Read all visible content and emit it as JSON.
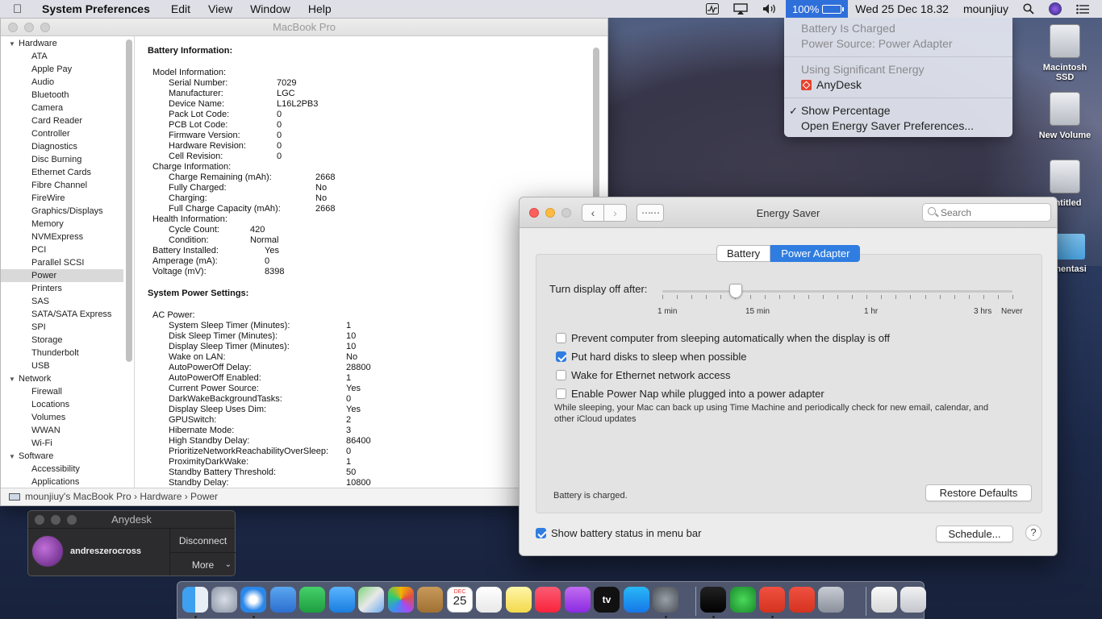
{
  "menubar": {
    "app": "System Preferences",
    "menus": [
      "Edit",
      "View",
      "Window",
      "Help"
    ],
    "battery_percent": "100%",
    "datetime": "Wed 25 Dec  18.32",
    "user": "mounjiuy"
  },
  "battery_menu": {
    "status": "Battery Is Charged",
    "source": "Power Source: Power Adapter",
    "energy_header": "Using Significant Energy",
    "energy_app": "AnyDesk",
    "show_percentage": "Show Percentage",
    "open_prefs": "Open Energy Saver Preferences..."
  },
  "desktop": {
    "icons": [
      "Macintosh SSD",
      "New Volume",
      "Untitled",
      "mentasi"
    ]
  },
  "sysinfo": {
    "title": "MacBook Pro",
    "tree": [
      {
        "label": "Hardware",
        "group": true
      },
      {
        "label": "ATA"
      },
      {
        "label": "Apple Pay"
      },
      {
        "label": "Audio"
      },
      {
        "label": "Bluetooth"
      },
      {
        "label": "Camera"
      },
      {
        "label": "Card Reader"
      },
      {
        "label": "Controller"
      },
      {
        "label": "Diagnostics"
      },
      {
        "label": "Disc Burning"
      },
      {
        "label": "Ethernet Cards"
      },
      {
        "label": "Fibre Channel"
      },
      {
        "label": "FireWire"
      },
      {
        "label": "Graphics/Displays"
      },
      {
        "label": "Memory"
      },
      {
        "label": "NVMExpress"
      },
      {
        "label": "PCI"
      },
      {
        "label": "Parallel SCSI"
      },
      {
        "label": "Power",
        "selected": true
      },
      {
        "label": "Printers"
      },
      {
        "label": "SAS"
      },
      {
        "label": "SATA/SATA Express"
      },
      {
        "label": "SPI"
      },
      {
        "label": "Storage"
      },
      {
        "label": "Thunderbolt"
      },
      {
        "label": "USB"
      },
      {
        "label": "Network",
        "group": true
      },
      {
        "label": "Firewall"
      },
      {
        "label": "Locations"
      },
      {
        "label": "Volumes"
      },
      {
        "label": "WWAN"
      },
      {
        "label": "Wi-Fi"
      },
      {
        "label": "Software",
        "group": true
      },
      {
        "label": "Accessibility"
      },
      {
        "label": "Applications"
      }
    ],
    "battery_heading": "Battery Information:",
    "battery_rows": [
      {
        "k": "Model Information:",
        "v": "",
        "indent": 0,
        "vx": 0
      },
      {
        "k": "Serial Number:",
        "v": "7029",
        "indent": 1,
        "vx": 134
      },
      {
        "k": "Manufacturer:",
        "v": "LGC",
        "indent": 1,
        "vx": 134
      },
      {
        "k": "Device Name:",
        "v": "L16L2PB3",
        "indent": 1,
        "vx": 134
      },
      {
        "k": "Pack Lot Code:",
        "v": "0",
        "indent": 1,
        "vx": 134
      },
      {
        "k": "PCB Lot Code:",
        "v": "0",
        "indent": 1,
        "vx": 134
      },
      {
        "k": "Firmware Version:",
        "v": "0",
        "indent": 1,
        "vx": 134
      },
      {
        "k": "Hardware Revision:",
        "v": "0",
        "indent": 1,
        "vx": 134
      },
      {
        "k": "Cell Revision:",
        "v": "0",
        "indent": 1,
        "vx": 134
      },
      {
        "k": "Charge Information:",
        "v": "",
        "indent": 0,
        "vx": 0
      },
      {
        "k": "Charge Remaining (mAh):",
        "v": "2668",
        "indent": 1,
        "vx": 182
      },
      {
        "k": "Fully Charged:",
        "v": "No",
        "indent": 1,
        "vx": 182
      },
      {
        "k": "Charging:",
        "v": "No",
        "indent": 1,
        "vx": 182
      },
      {
        "k": "Full Charge Capacity (mAh):",
        "v": "2668",
        "indent": 1,
        "vx": 182
      },
      {
        "k": "Health Information:",
        "v": "",
        "indent": 0,
        "vx": 0
      },
      {
        "k": "Cycle Count:",
        "v": "420",
        "indent": 1,
        "vx": 101
      },
      {
        "k": "Condition:",
        "v": "Normal",
        "indent": 1,
        "vx": 101
      },
      {
        "k": "Battery Installed:",
        "v": "Yes",
        "indent": 0,
        "vx": 119
      },
      {
        "k": "Amperage (mA):",
        "v": "0",
        "indent": 0,
        "vx": 119
      },
      {
        "k": "Voltage (mV):",
        "v": "8398",
        "indent": 0,
        "vx": 119
      }
    ],
    "power_heading": "System Power Settings:",
    "power_rows": [
      {
        "k": "AC Power:",
        "v": "",
        "indent": 0
      },
      {
        "k": "System Sleep Timer (Minutes):",
        "v": "1",
        "indent": 1
      },
      {
        "k": "Disk Sleep Timer (Minutes):",
        "v": "10",
        "indent": 1
      },
      {
        "k": "Display Sleep Timer (Minutes):",
        "v": "10",
        "indent": 1
      },
      {
        "k": "Wake on LAN:",
        "v": "No",
        "indent": 1
      },
      {
        "k": "AutoPowerOff Delay:",
        "v": "28800",
        "indent": 1
      },
      {
        "k": "AutoPowerOff Enabled:",
        "v": "1",
        "indent": 1
      },
      {
        "k": "Current Power Source:",
        "v": "Yes",
        "indent": 1
      },
      {
        "k": "DarkWakeBackgroundTasks:",
        "v": "0",
        "indent": 1
      },
      {
        "k": "Display Sleep Uses Dim:",
        "v": "Yes",
        "indent": 1
      },
      {
        "k": "GPUSwitch:",
        "v": "2",
        "indent": 1
      },
      {
        "k": "Hibernate Mode:",
        "v": "3",
        "indent": 1
      },
      {
        "k": "High Standby Delay:",
        "v": "86400",
        "indent": 1
      },
      {
        "k": "PrioritizeNetworkReachabilityOverSleep:",
        "v": "0",
        "indent": 1
      },
      {
        "k": "ProximityDarkWake:",
        "v": "1",
        "indent": 1
      },
      {
        "k": "Standby Battery Threshold:",
        "v": "50",
        "indent": 1
      },
      {
        "k": "Standby Delay:",
        "v": "10800",
        "indent": 1
      }
    ],
    "path": "mounjiuy's MacBook Pro  ›  Hardware  ›  Power"
  },
  "anydesk": {
    "title": "Anydesk",
    "user": "andreszerocross",
    "disconnect": "Disconnect",
    "more": "More"
  },
  "energy": {
    "title": "Energy Saver",
    "search_placeholder": "Search",
    "tabs": [
      "Battery",
      "Power Adapter"
    ],
    "active_tab": "Power Adapter",
    "slider_label": "Turn display off after:",
    "slider_value": "10 min",
    "slider_fraction": 0.21,
    "ticks": [
      "1 min",
      "15 min",
      "1 hr",
      "3 hrs",
      "Never"
    ],
    "options": [
      {
        "label": "Prevent computer from sleeping automatically when the display is off",
        "checked": false
      },
      {
        "label": "Put hard disks to sleep when possible",
        "checked": true
      },
      {
        "label": "Wake for Ethernet network access",
        "checked": false
      },
      {
        "label": "Enable Power Nap while plugged into a power adapter",
        "checked": false
      }
    ],
    "power_nap_desc": "While sleeping, your Mac can back up using Time Machine and periodically check for new email, calendar, and other iCloud updates",
    "status": "Battery is charged.",
    "restore": "Restore Defaults",
    "show_status": "Show battery status in menu bar",
    "show_status_checked": true,
    "schedule": "Schedule...",
    "help": "?"
  },
  "dock": {
    "apps": [
      "finder-icon",
      "launchpad-icon",
      "safari-icon",
      "mail-icon",
      "facetime-icon",
      "messages-icon",
      "maps-icon",
      "photos-icon",
      "contacts-icon",
      "calendar-icon",
      "reminders-icon",
      "notes-icon",
      "music-icon",
      "podcasts-icon",
      "tv-icon",
      "app-store-icon",
      "system-preferences-icon",
      "terminal-icon",
      "activity-icon",
      "anydesk-icon",
      "anydesk-icon-2",
      "utility-icon",
      "documents-icon",
      "trash-icon"
    ],
    "calendar_day": "25",
    "calendar_month": "DEC",
    "tv_label": "tv"
  },
  "colors": {
    "accent": "#2f7de1",
    "close": "#fc605c",
    "minimize": "#fdbc40",
    "zoom": "#c8c8c8"
  }
}
